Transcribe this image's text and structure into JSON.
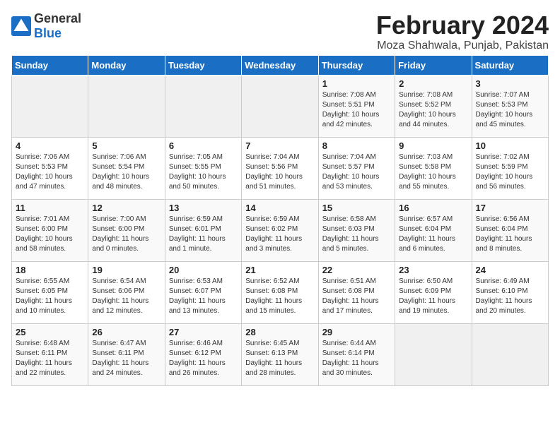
{
  "header": {
    "logo_general": "General",
    "logo_blue": "Blue",
    "month_year": "February 2024",
    "location": "Moza Shahwala, Punjab, Pakistan"
  },
  "days_of_week": [
    "Sunday",
    "Monday",
    "Tuesday",
    "Wednesday",
    "Thursday",
    "Friday",
    "Saturday"
  ],
  "weeks": [
    [
      {
        "day": "",
        "info": ""
      },
      {
        "day": "",
        "info": ""
      },
      {
        "day": "",
        "info": ""
      },
      {
        "day": "",
        "info": ""
      },
      {
        "day": "1",
        "info": "Sunrise: 7:08 AM\nSunset: 5:51 PM\nDaylight: 10 hours\nand 42 minutes."
      },
      {
        "day": "2",
        "info": "Sunrise: 7:08 AM\nSunset: 5:52 PM\nDaylight: 10 hours\nand 44 minutes."
      },
      {
        "day": "3",
        "info": "Sunrise: 7:07 AM\nSunset: 5:53 PM\nDaylight: 10 hours\nand 45 minutes."
      }
    ],
    [
      {
        "day": "4",
        "info": "Sunrise: 7:06 AM\nSunset: 5:53 PM\nDaylight: 10 hours\nand 47 minutes."
      },
      {
        "day": "5",
        "info": "Sunrise: 7:06 AM\nSunset: 5:54 PM\nDaylight: 10 hours\nand 48 minutes."
      },
      {
        "day": "6",
        "info": "Sunrise: 7:05 AM\nSunset: 5:55 PM\nDaylight: 10 hours\nand 50 minutes."
      },
      {
        "day": "7",
        "info": "Sunrise: 7:04 AM\nSunset: 5:56 PM\nDaylight: 10 hours\nand 51 minutes."
      },
      {
        "day": "8",
        "info": "Sunrise: 7:04 AM\nSunset: 5:57 PM\nDaylight: 10 hours\nand 53 minutes."
      },
      {
        "day": "9",
        "info": "Sunrise: 7:03 AM\nSunset: 5:58 PM\nDaylight: 10 hours\nand 55 minutes."
      },
      {
        "day": "10",
        "info": "Sunrise: 7:02 AM\nSunset: 5:59 PM\nDaylight: 10 hours\nand 56 minutes."
      }
    ],
    [
      {
        "day": "11",
        "info": "Sunrise: 7:01 AM\nSunset: 6:00 PM\nDaylight: 10 hours\nand 58 minutes."
      },
      {
        "day": "12",
        "info": "Sunrise: 7:00 AM\nSunset: 6:00 PM\nDaylight: 11 hours\nand 0 minutes."
      },
      {
        "day": "13",
        "info": "Sunrise: 6:59 AM\nSunset: 6:01 PM\nDaylight: 11 hours\nand 1 minute."
      },
      {
        "day": "14",
        "info": "Sunrise: 6:59 AM\nSunset: 6:02 PM\nDaylight: 11 hours\nand 3 minutes."
      },
      {
        "day": "15",
        "info": "Sunrise: 6:58 AM\nSunset: 6:03 PM\nDaylight: 11 hours\nand 5 minutes."
      },
      {
        "day": "16",
        "info": "Sunrise: 6:57 AM\nSunset: 6:04 PM\nDaylight: 11 hours\nand 6 minutes."
      },
      {
        "day": "17",
        "info": "Sunrise: 6:56 AM\nSunset: 6:04 PM\nDaylight: 11 hours\nand 8 minutes."
      }
    ],
    [
      {
        "day": "18",
        "info": "Sunrise: 6:55 AM\nSunset: 6:05 PM\nDaylight: 11 hours\nand 10 minutes."
      },
      {
        "day": "19",
        "info": "Sunrise: 6:54 AM\nSunset: 6:06 PM\nDaylight: 11 hours\nand 12 minutes."
      },
      {
        "day": "20",
        "info": "Sunrise: 6:53 AM\nSunset: 6:07 PM\nDaylight: 11 hours\nand 13 minutes."
      },
      {
        "day": "21",
        "info": "Sunrise: 6:52 AM\nSunset: 6:08 PM\nDaylight: 11 hours\nand 15 minutes."
      },
      {
        "day": "22",
        "info": "Sunrise: 6:51 AM\nSunset: 6:08 PM\nDaylight: 11 hours\nand 17 minutes."
      },
      {
        "day": "23",
        "info": "Sunrise: 6:50 AM\nSunset: 6:09 PM\nDaylight: 11 hours\nand 19 minutes."
      },
      {
        "day": "24",
        "info": "Sunrise: 6:49 AM\nSunset: 6:10 PM\nDaylight: 11 hours\nand 20 minutes."
      }
    ],
    [
      {
        "day": "25",
        "info": "Sunrise: 6:48 AM\nSunset: 6:11 PM\nDaylight: 11 hours\nand 22 minutes."
      },
      {
        "day": "26",
        "info": "Sunrise: 6:47 AM\nSunset: 6:11 PM\nDaylight: 11 hours\nand 24 minutes."
      },
      {
        "day": "27",
        "info": "Sunrise: 6:46 AM\nSunset: 6:12 PM\nDaylight: 11 hours\nand 26 minutes."
      },
      {
        "day": "28",
        "info": "Sunrise: 6:45 AM\nSunset: 6:13 PM\nDaylight: 11 hours\nand 28 minutes."
      },
      {
        "day": "29",
        "info": "Sunrise: 6:44 AM\nSunset: 6:14 PM\nDaylight: 11 hours\nand 30 minutes."
      },
      {
        "day": "",
        "info": ""
      },
      {
        "day": "",
        "info": ""
      }
    ]
  ]
}
